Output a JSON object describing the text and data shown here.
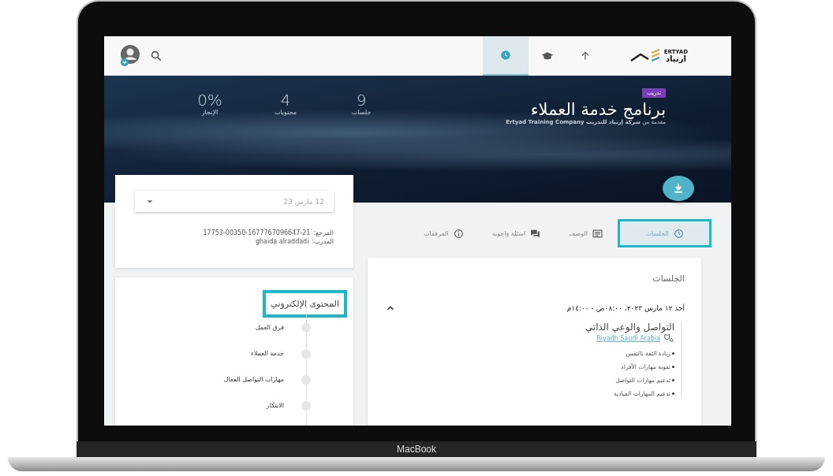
{
  "laptop": {
    "label": "MacBook"
  },
  "header": {
    "logo": {
      "latin": "ERTYAD",
      "arabic": "ارتياد"
    },
    "nav": [
      {
        "kind": "arrow",
        "selected": false
      },
      {
        "kind": "cap",
        "selected": false
      },
      {
        "kind": "clock",
        "selected": true
      }
    ]
  },
  "hero": {
    "badge": "تدريب",
    "title": "برنامج خدمة العملاء",
    "subtitle": "مقدمة من **شركة إرتياد للتدريب Ertyad Training Company**",
    "stats": [
      {
        "value": "9",
        "label": "جلسات"
      },
      {
        "value": "4",
        "label": "محتويات"
      },
      {
        "value": "0%",
        "label": "الإنجاز"
      }
    ]
  },
  "tabs": [
    {
      "kind": "clock",
      "label": "الجلسات",
      "selected": true,
      "highlighted": true
    },
    {
      "kind": "description",
      "label": "الوصف",
      "selected": false,
      "highlighted": false
    },
    {
      "kind": "chat",
      "label": "اسئلة واجوبة",
      "selected": false,
      "highlighted": false
    },
    {
      "kind": "info",
      "label": "المرفقات",
      "selected": false,
      "highlighted": false
    }
  ],
  "sessions": {
    "title": "الجلسات",
    "session": {
      "date": "أحد ١٢ مارس ٢٠٢٣، ٠٨:٠٠ص - ١٤:٠٠م",
      "expanded": true,
      "topic": "التواصل والوعي الذاتي",
      "location": "Riyadh Saudi Arabia",
      "points": [
        "زيادة الثقة بالنفس",
        "تقوية مهارات الأفراد",
        "تدعيم مهارات التواصل",
        "تدعيم المهارات القيادية"
      ]
    }
  },
  "info_card": {
    "date_select": {
      "value": "12 مارس 23"
    },
    "fields": [
      {
        "label": "المرجع:",
        "value": "17753-00350-1677767096647-21"
      },
      {
        "label": "المدرب:",
        "value": "ghaida alraddadi"
      }
    ]
  },
  "content_card": {
    "title": "المحتوى الإلكتروني",
    "highlighted": true,
    "items": [
      "فرق العمل",
      "خدمة العملاء",
      "مهارات التواصل الفعال",
      "الابتكار"
    ]
  }
}
